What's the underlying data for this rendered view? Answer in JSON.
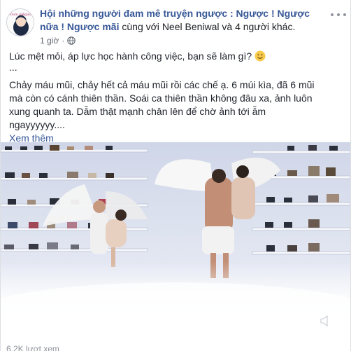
{
  "post": {
    "group_name_line1": "Hội những người đam mê truyện ngược : Ngược ! Ngược",
    "group_name_line2": "nữa ! Ngược mãi",
    "with_text": " cùng với ",
    "tagged_person": "Neel Beniwal",
    "and_others": " và 4 người khác.",
    "timestamp": "1 giờ",
    "separator": "·",
    "privacy_icon": "globe-icon",
    "menu_icon": "more-options-icon"
  },
  "content": {
    "line1": "Lúc mệt mỏi, áp lực học hành công việc, bạn sẽ làm gì?",
    "ellipsis": "...",
    "paragraph": "Chảy máu mũi, chảy hết cả máu mũi rồi các chế ạ. 6 múi kìa, đã 6 mũi mà còn có cánh thiên thần. Soái ca thiên thần không đâu xa, ảnh luôn xung quanh ta. Dẫm thật mạnh chân lên để chờ ảnh tới ẫm ngayyyyyy....",
    "see_more": "Xem thêm",
    "emoji_icon": "smile-icon"
  },
  "video": {
    "description_icon": "video-thumbnail",
    "volume_icon": "volume-icon"
  },
  "footer": {
    "views": "6,2K lượt xem"
  },
  "colors": {
    "link": "#385898",
    "meta": "#616770",
    "text": "#1d2129"
  }
}
